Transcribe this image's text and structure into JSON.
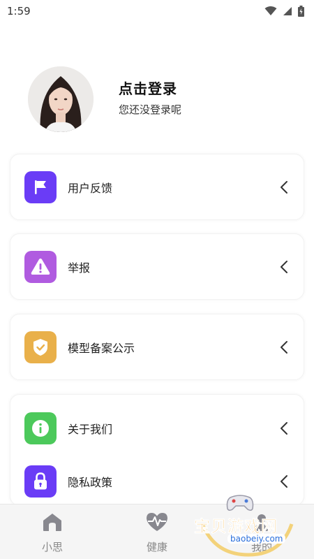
{
  "status_bar": {
    "time": "1:59"
  },
  "profile": {
    "title": "点击登录",
    "subtitle": "您还没登录呢"
  },
  "menu": {
    "feedback": {
      "label": "用户反馈",
      "color": "#6a3cf6"
    },
    "report": {
      "label": "举报",
      "color": "#b05be0"
    },
    "model_filing": {
      "label": "模型备案公示",
      "color": "#e9b04a"
    },
    "about": {
      "label": "关于我们",
      "color": "#4cc95b"
    },
    "privacy": {
      "label": "隐私政策",
      "color": "#6a3cf6"
    }
  },
  "tabbar": {
    "tabs": [
      {
        "label": "小思"
      },
      {
        "label": "健康"
      },
      {
        "label": "我的"
      }
    ]
  },
  "watermark": {
    "text": "宝贝游戏网",
    "url": "baobeiy.com"
  }
}
